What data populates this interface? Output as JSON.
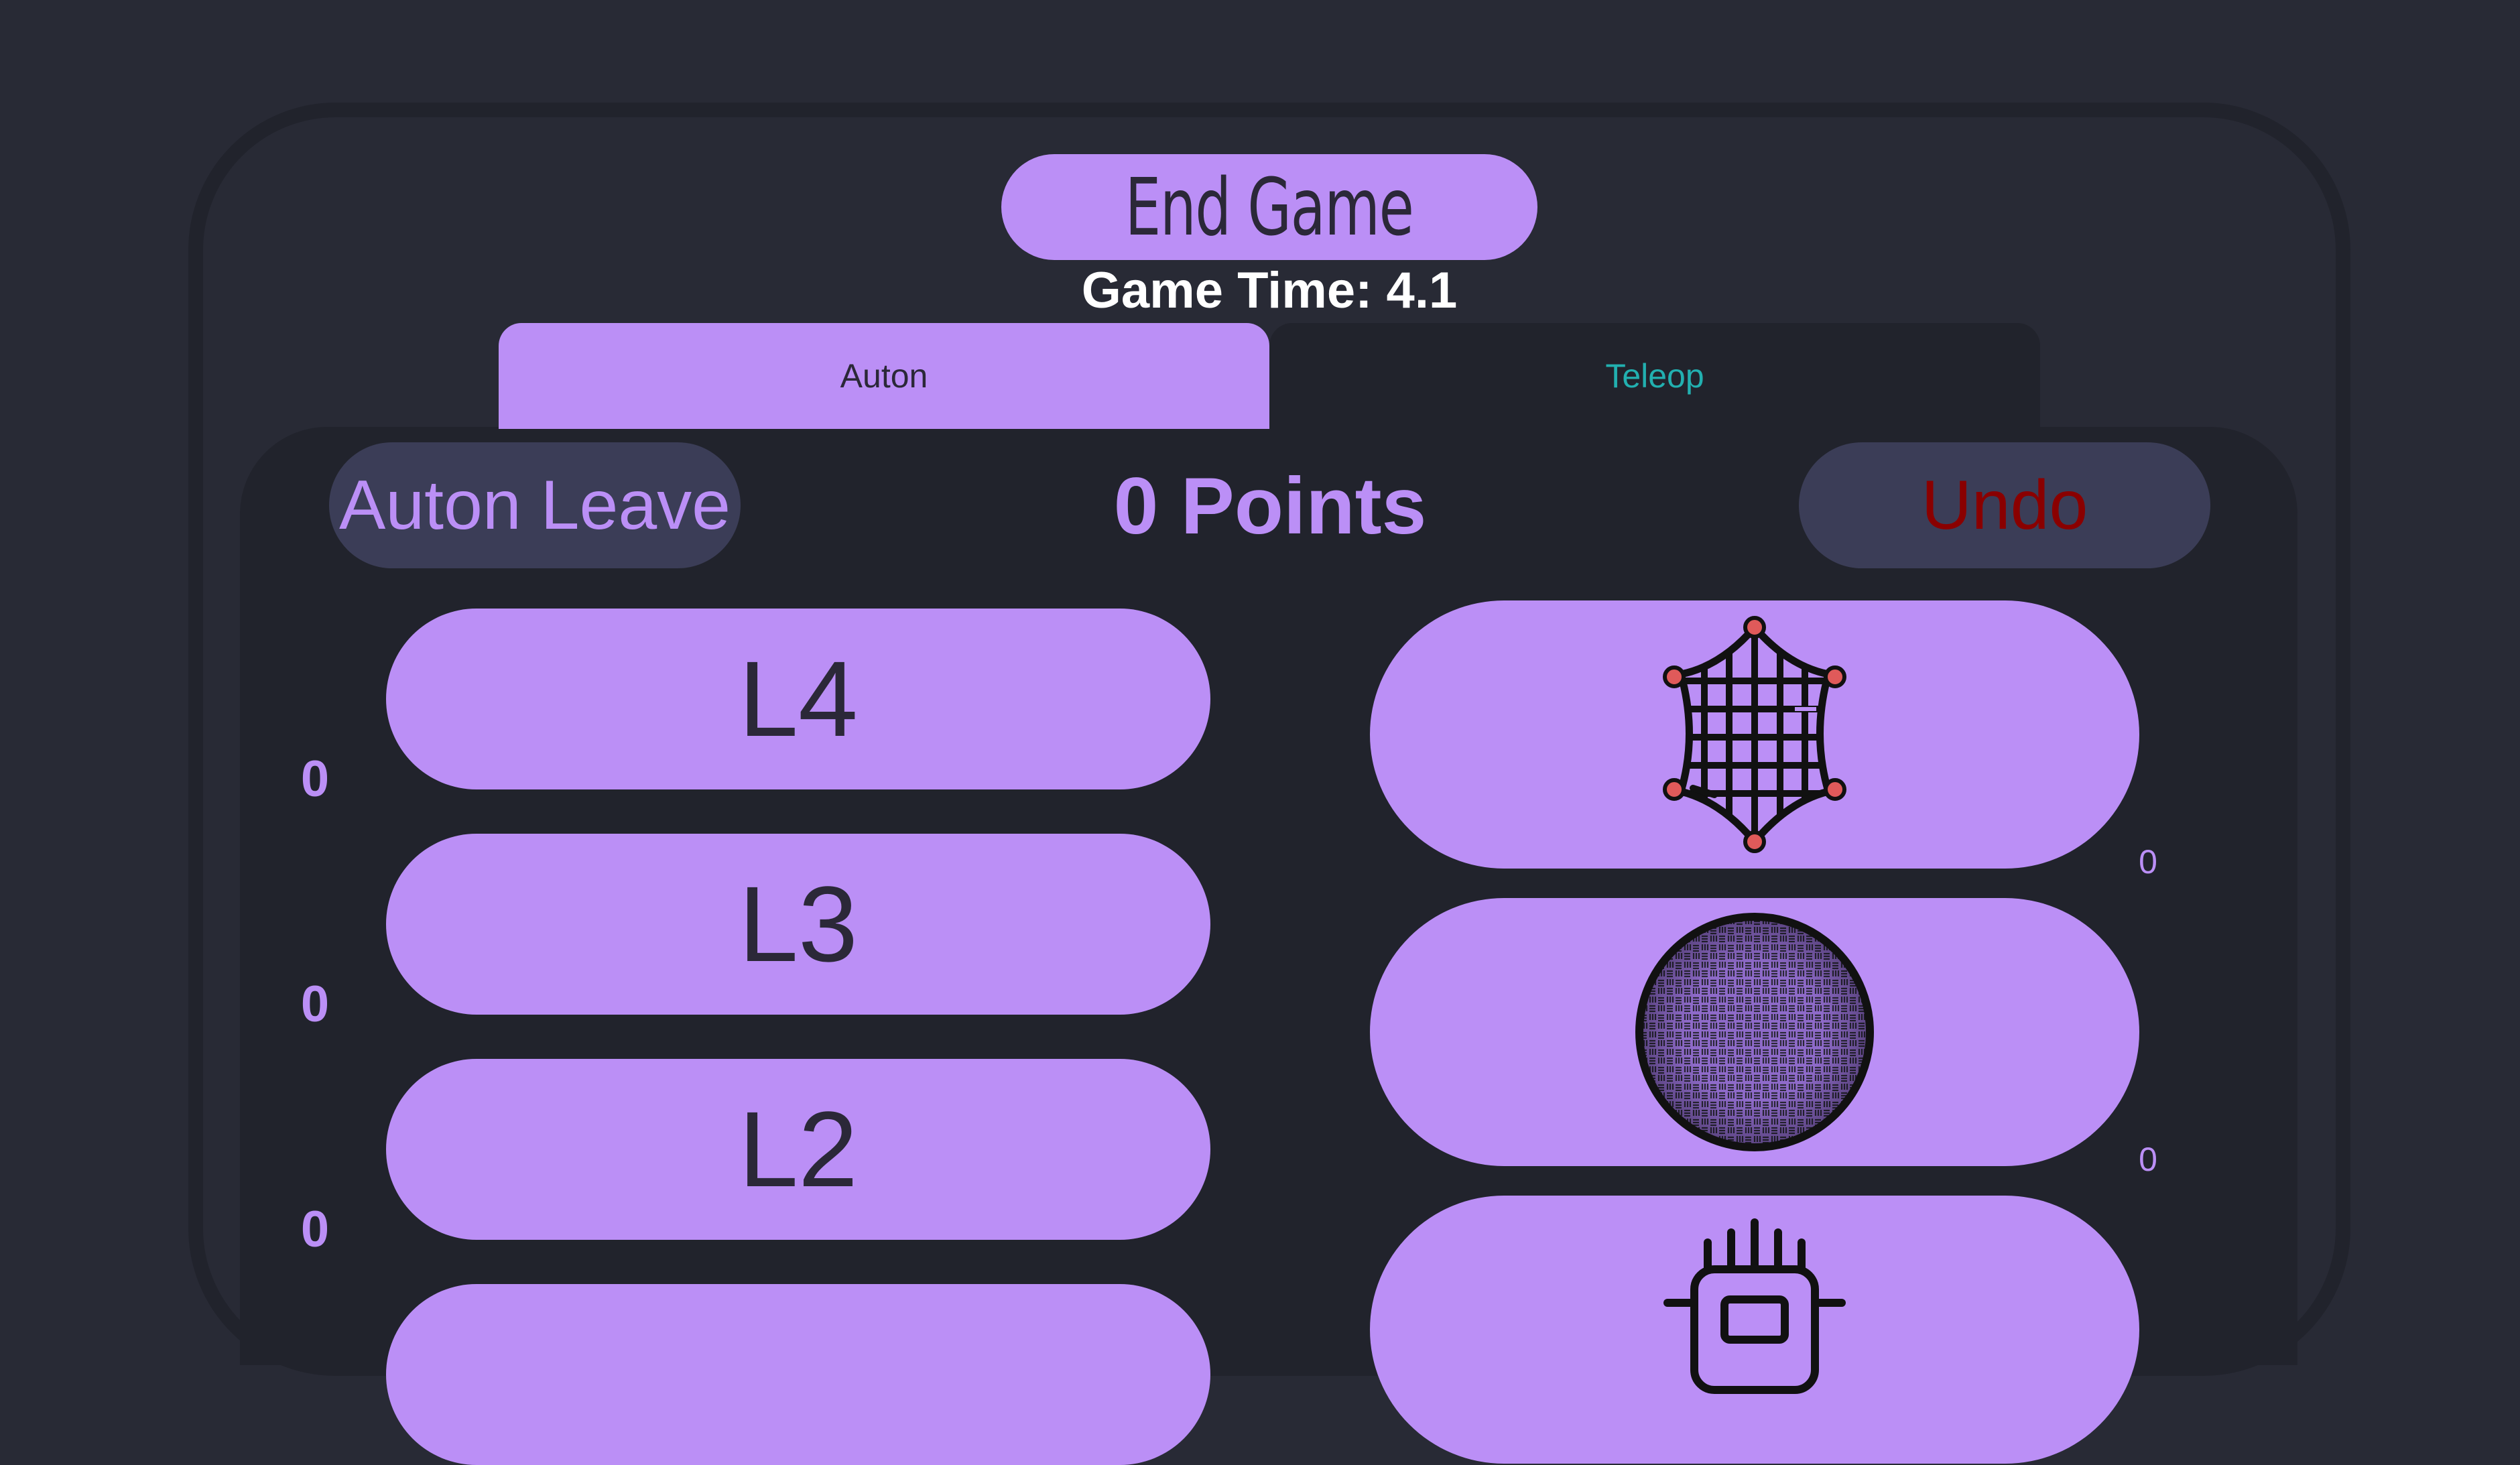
{
  "header": {
    "end_game_label": "End Game",
    "game_time_label": "Game Time: 4.1"
  },
  "tabs": [
    {
      "label": "Auton",
      "active": true
    },
    {
      "label": "Teleop",
      "active": false
    }
  ],
  "controls": {
    "auton_leave_label": "Auton Leave",
    "points_label": "0 Points",
    "undo_label": "Undo"
  },
  "levels": [
    {
      "label": "L4",
      "count": "0"
    },
    {
      "label": "L3",
      "count": "0"
    },
    {
      "label": "L2",
      "count": "0"
    }
  ],
  "game_pieces": [
    {
      "icon": "net-icon",
      "count": "0"
    },
    {
      "icon": "ball-icon",
      "count": "0"
    },
    {
      "icon": "processor-icon"
    }
  ],
  "colors": {
    "background": "#282a35",
    "panel": "#21232c",
    "accent": "#bb8ff6",
    "button_dark": "#3b3d57",
    "undo_text": "#8a0000",
    "teleop_text": "#22b0b0",
    "net_node": "#e05a5a"
  }
}
